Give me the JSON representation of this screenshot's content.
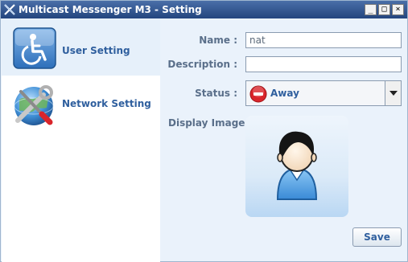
{
  "window": {
    "title": "Multicast Messenger M3 - Setting",
    "controls": {
      "minimize": "_",
      "maximize": "□",
      "close": "×"
    }
  },
  "sidebar": {
    "items": [
      {
        "label": "User Setting",
        "icon": "wheelchair-user-icon",
        "selected": true
      },
      {
        "label": "Network Setting",
        "icon": "globe-tools-icon",
        "selected": false
      }
    ]
  },
  "form": {
    "name_label": "Name :",
    "name_value": "nat",
    "description_label": "Description :",
    "description_value": "",
    "status_label": "Status :",
    "status_value": "Away",
    "status_icon": "away-minus-icon",
    "display_image_label": "Display Image :",
    "display_image_icon": "user-avatar-icon"
  },
  "actions": {
    "save_label": "Save"
  },
  "colors": {
    "titlebar": "#23457e",
    "accent_text": "#2f5f9e",
    "label_text": "#5a6f8a",
    "panel_bg": "#eaf2fb",
    "away_red": "#d9252b"
  }
}
